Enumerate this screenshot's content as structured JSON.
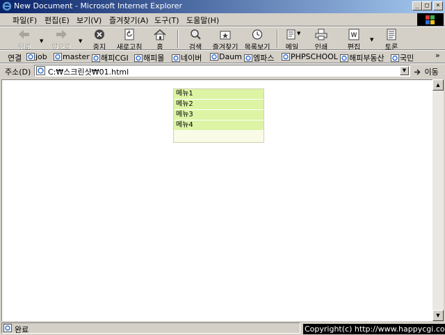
{
  "window": {
    "title": "New Document - Microsoft Internet Explorer",
    "controls": {
      "minimize": "_",
      "maximize": "□",
      "close": "×"
    }
  },
  "menubar": {
    "items": [
      "파일(F)",
      "편집(E)",
      "보기(V)",
      "즐겨찾기(A)",
      "도구(T)",
      "도움말(H)"
    ]
  },
  "toolbar": {
    "back": "뒤로",
    "forward": "앞으로",
    "stop": "중지",
    "refresh": "새로고침",
    "home": "홈",
    "search": "검색",
    "favorites": "즐겨찾기",
    "history": "목록보기",
    "mail": "메일",
    "print": "인쇄",
    "edit": "편집",
    "discuss": "토론"
  },
  "links": {
    "label": "연결",
    "items": [
      "job",
      "master",
      "해피CGI",
      "해피몰",
      "네이버",
      "Daum",
      "엠파스",
      "PHPSCHOOL",
      "해피부동산",
      "국민"
    ],
    "more": "»"
  },
  "address": {
    "label": "주소(D)",
    "value": "C:₩스크린샷₩01.html",
    "go": "이동"
  },
  "content": {
    "menu": [
      "메뉴1",
      "메뉴2",
      "메뉴3",
      "메뉴4"
    ]
  },
  "status": {
    "text": "완료"
  },
  "watermark": "Copyright(c) http://www.happycgi.com",
  "colors": {
    "menu_row_bg": "#dcf4a4",
    "titlebar_start": "#0a246a",
    "titlebar_end": "#a6caf0"
  }
}
